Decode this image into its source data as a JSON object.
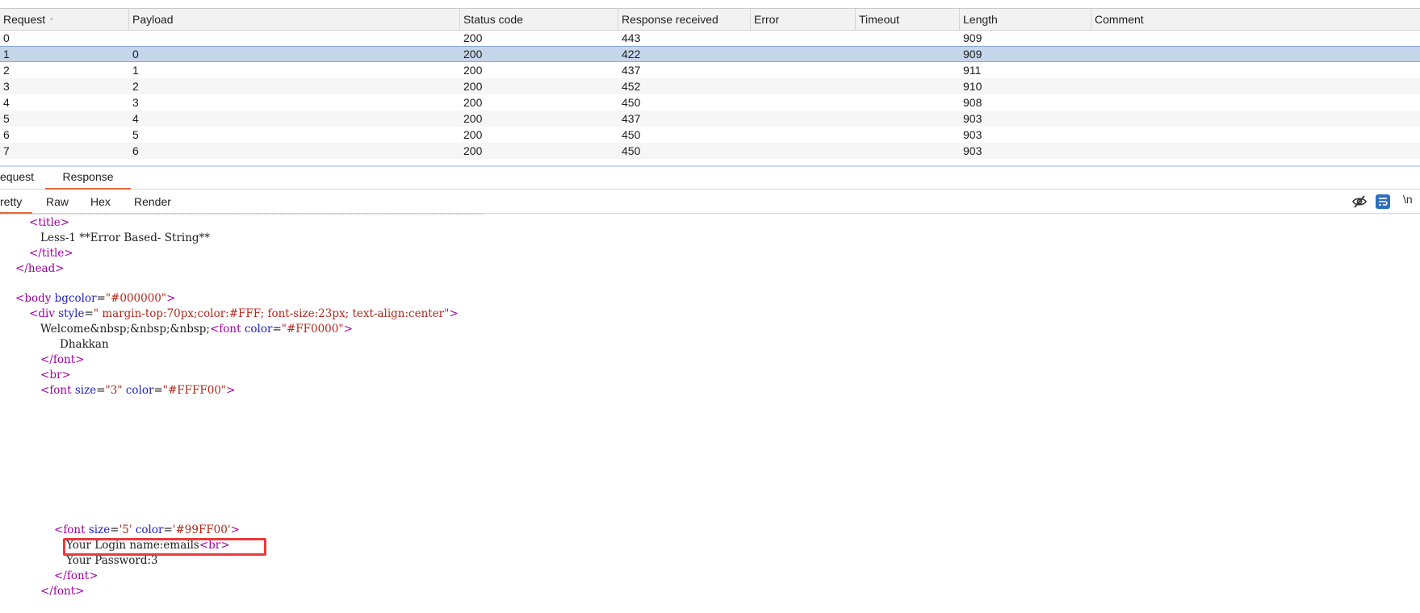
{
  "table": {
    "columns": [
      "Request",
      "Payload",
      "Status code",
      "Response received",
      "Error",
      "Timeout",
      "Length",
      "Comment"
    ],
    "rows": [
      {
        "request": "0",
        "payload": "",
        "status": "200",
        "received": "443",
        "length": "909"
      },
      {
        "request": "1",
        "payload": "0",
        "status": "200",
        "received": "422",
        "length": "909"
      },
      {
        "request": "2",
        "payload": "1",
        "status": "200",
        "received": "437",
        "length": "911"
      },
      {
        "request": "3",
        "payload": "2",
        "status": "200",
        "received": "452",
        "length": "910"
      },
      {
        "request": "4",
        "payload": "3",
        "status": "200",
        "received": "450",
        "length": "908"
      },
      {
        "request": "5",
        "payload": "4",
        "status": "200",
        "received": "437",
        "length": "903"
      },
      {
        "request": "6",
        "payload": "5",
        "status": "200",
        "received": "450",
        "length": "903"
      },
      {
        "request": "7",
        "payload": "6",
        "status": "200",
        "received": "450",
        "length": "903"
      }
    ],
    "selected_row": "1"
  },
  "message_tabs": {
    "request": "equest",
    "response": "Response"
  },
  "view_tabs": {
    "pretty": "retty",
    "raw": "Raw",
    "hex": "Hex",
    "render": "Render",
    "newline_toggle": "\\n"
  },
  "icons": {
    "hide": "eye-slash-icon",
    "wrap": "word-wrap-icon"
  },
  "code": {
    "l1_open": "<",
    "l1_tag": "title",
    "l1_close": ">",
    "l2_text": "Less-1 **Error Based- String**",
    "l3_open": "</",
    "l3_tag": "title",
    "l3_close": ">",
    "l4_open": "</",
    "l4_tag": "head",
    "l4_close": ">",
    "l5_open": "<",
    "l5_tag": "body",
    "l5_attr": "bgcolor",
    "l5_eq": "=",
    "l5_val": "\"#000000\"",
    "l5_close": ">",
    "l6_open": "<",
    "l6_tag": "div",
    "l6_attr": "style",
    "l6_eq": "=",
    "l6_val": "\" margin-top:70px;color:#FFF; font-size:23px; text-align:center\"",
    "l6_close": ">",
    "l7_text": "Welcome&nbsp;&nbsp;&nbsp;",
    "l7_open": "<",
    "l7_tag": "font",
    "l7_attr": "color",
    "l7_eq": "=",
    "l7_val": "\"#FF0000\"",
    "l7_close": ">",
    "l8_text": "Dhakkan",
    "l9_open": "</",
    "l9_tag": "font",
    "l9_close": ">",
    "l10_open": "<",
    "l10_tag": "br",
    "l10_close": ">",
    "l11_open": "<",
    "l11_tag": "font",
    "l11_attr1": "size",
    "l11_eq1": "=",
    "l11_val1": "\"3\"",
    "l11_attr2": "color",
    "l11_eq2": "=",
    "l11_val2": "\"#FFFF00\"",
    "l11_close": ">",
    "l12_open": "<",
    "l12_tag": "font",
    "l12_attr1": "size",
    "l12_eq1": "=",
    "l12_val1": "'5'",
    "l12_attr2": "color",
    "l12_eq2": "=",
    "l12_val2": "'#99FF00'",
    "l12_close": ">",
    "l13_text": "Your Login name:emails",
    "l13_open": "<",
    "l13_tag": "br",
    "l13_close": ">",
    "l14_text": "Your Password:3",
    "l15_open": "</",
    "l15_tag": "font",
    "l15_close": ">",
    "l16_open": "</",
    "l16_tag": "font",
    "l16_close": ">"
  },
  "colors": {
    "accent_tab": "#e8663d",
    "selected_row": "#c5d5ea",
    "highlight_box": "#e83b3b",
    "tag": "#a000a0",
    "attr": "#2020c0",
    "value": "#b0281c"
  }
}
